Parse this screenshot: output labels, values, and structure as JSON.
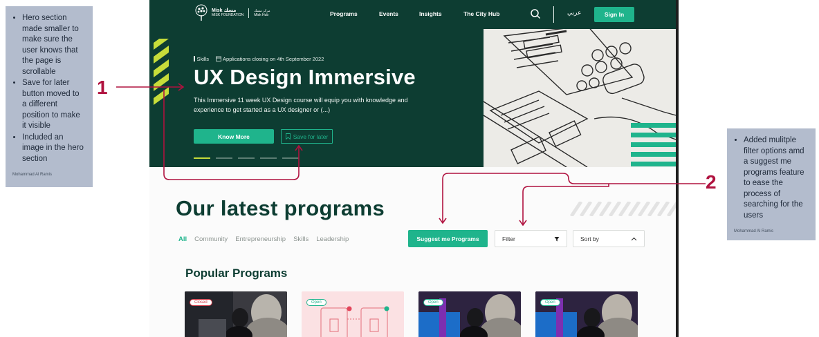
{
  "annotations": {
    "left": {
      "items": [
        "Hero section made smaller to make sure the user knows that the page is scrollable",
        "Save for later button moved to a different position to make it visible",
        "Included an image in the hero section"
      ],
      "author": "Mohammad Al Ramis",
      "marker": "1"
    },
    "right": {
      "items": [
        "Added mulitple filter options amd a suggest me programs feature to ease the process of searching for the users"
      ],
      "author": "Mohammad Al Ramis",
      "marker": "2"
    }
  },
  "nav": {
    "logo_main": "Misk مسك",
    "logo_sub": "MISK FOUNDATION",
    "hub_ar": "مركز مسك",
    "hub_en": "Misk Hub",
    "links": [
      "Programs",
      "Events",
      "Insights",
      "The City Hub"
    ],
    "lang": "عربي",
    "signin": "Sign In"
  },
  "hero": {
    "category": "Skills",
    "closing": "Applications closing on 4th September 2022",
    "title": "UX Design Immersive",
    "description": "This Immersive 11 week UX Design course will equip you with knowledge and experience to get started as a UX designer or (...)",
    "know_more": "Know More",
    "save_later": "Save for later",
    "slides": 5,
    "active_slide": 0
  },
  "programs": {
    "title": "Our latest programs",
    "tabs": [
      "All",
      "Community",
      "Entrepreneurship",
      "Skills",
      "Leadership"
    ],
    "active_tab": 0,
    "suggest": "Suggest me Programs",
    "filter": "Filter",
    "sort": "Sort by",
    "popular_title": "Popular Programs",
    "cards": [
      {
        "status": "Closed"
      },
      {
        "status": "Open"
      },
      {
        "status": "Open"
      },
      {
        "status": "Open"
      }
    ]
  },
  "colors": {
    "hero_bg": "#0d3d32",
    "accent": "#1fb48c",
    "lime": "#c7dd3a",
    "annotation": "#b0123f"
  }
}
